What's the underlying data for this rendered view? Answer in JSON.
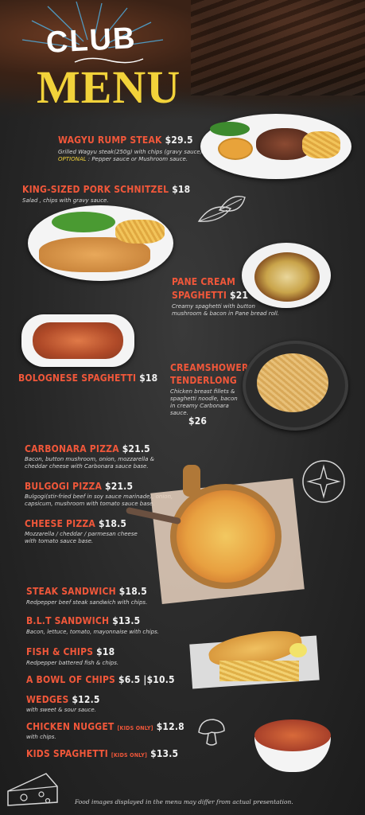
{
  "header": {
    "club": "CLUB",
    "menu": "MENU"
  },
  "items": [
    {
      "name": "WAGYU RUMP STEAK",
      "price": "$29.5",
      "desc": "Grilled Wagyu steak(250g) with chips (gravy sauce)",
      "optional_label": "OPTIONAL",
      "optional_text": " : Pepper sauce or Mushroom sauce."
    },
    {
      "name": "KING-SIZED PORK SCHNITZEL",
      "price": "$18",
      "desc": "Salad , chips with gravy sauce."
    },
    {
      "name_line1": "PANE CREAM",
      "name_line2": "SPAGHETTI",
      "price": "$21",
      "desc": "Creamy spaghetti with button mushroom & bacon in Pane bread roll."
    },
    {
      "name": "BOLOGNESE SPAGHETTI",
      "price": "$18"
    },
    {
      "name_line1": "CREAMSHOWER",
      "name_line2": "TENDERLONG",
      "desc": "Chicken breast fillets & spaghetti noodle, bacon in creamy Carbonara sauce.",
      "price": "$26"
    },
    {
      "name": "CARBONARA PIZZA",
      "price": "$21.5",
      "desc": "Bacon, button mushroom, onion, mozzarella & cheddar cheese with Carbonara sauce base."
    },
    {
      "name": "BULGOGI PIZZA",
      "price": "$21.5",
      "desc": "Bulgogi(stir-fried beef in soy sauce marinade), onion, capsicum, mushroom with tomato sauce base."
    },
    {
      "name": "CHEESE PIZZA",
      "price": "$18.5",
      "desc": "Mozzarella / cheddar / parmesan cheese with tomato sauce base."
    },
    {
      "name": "STEAK SANDWICH",
      "price": "$18.5",
      "desc": "Redpepper beef steak sandwich with chips."
    },
    {
      "name": "B.L.T SANDWICH",
      "price": "$13.5",
      "desc": "Bacon, lettuce, tomato, mayonnaise with chips."
    },
    {
      "name": "FISH & CHIPS",
      "price": "$18",
      "desc": "Redpepper battered fish & chips."
    },
    {
      "name": "A BOWL OF CHIPS",
      "price": "$6.5",
      "price2": "$10.5"
    },
    {
      "name": "WEDGES",
      "price": "$12.5",
      "desc": "with sweet & sour sauce."
    },
    {
      "name": "CHICKEN NUGGET",
      "tag": "[KIDS ONLY]",
      "price": "$12.8",
      "desc": "with chips."
    },
    {
      "name": "KIDS SPAGHETTI",
      "tag": "[KIDS ONLY]",
      "price": "$13.5"
    }
  ],
  "footer": "Food images displayed in the menu may differ from actual presentation.",
  "colors": {
    "item_name": "#f0573a",
    "title_yellow": "#f2d23a",
    "background": "#262626"
  }
}
